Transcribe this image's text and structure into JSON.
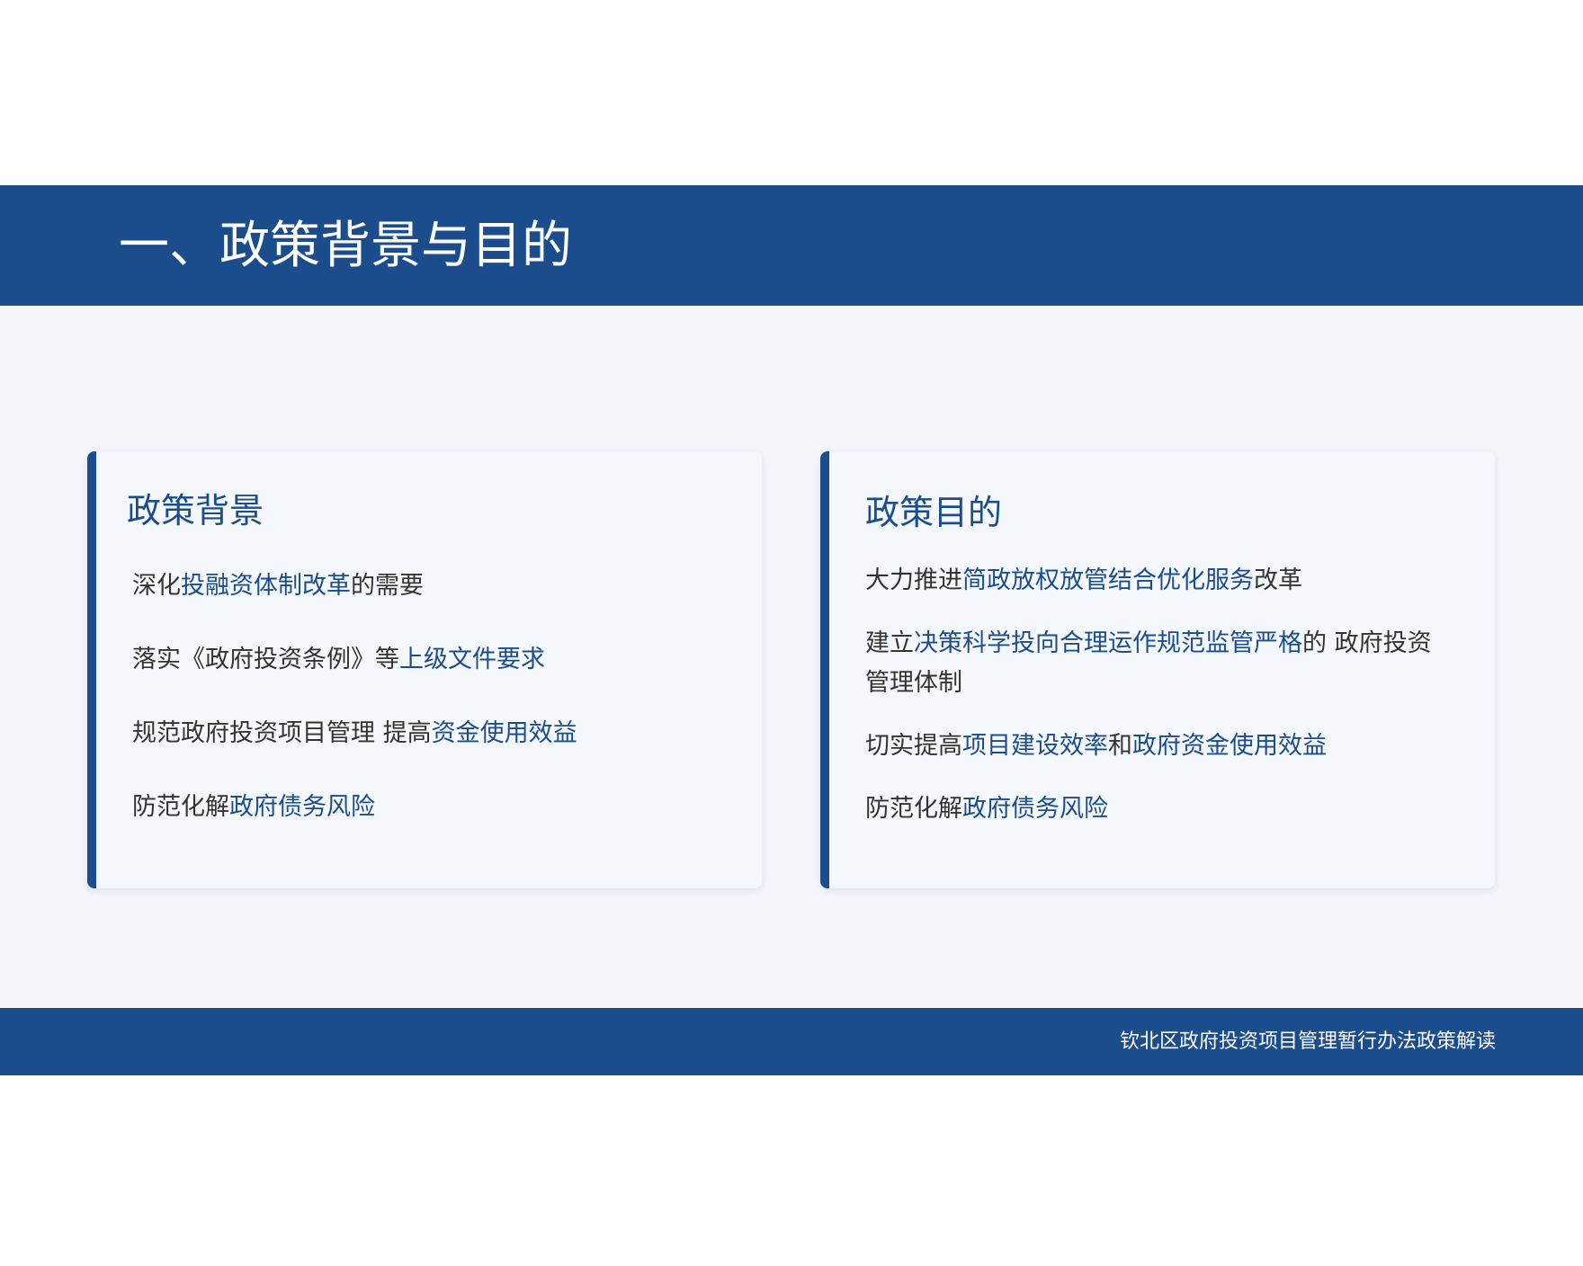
{
  "header": {
    "title": "一、政策背景与目的"
  },
  "cards": [
    {
      "title": "政策背景",
      "items": [
        [
          {
            "text": "深化",
            "hl": false
          },
          {
            "text": "投融资体制改革",
            "hl": true
          },
          {
            "text": "的需要",
            "hl": false
          }
        ],
        [
          {
            "text": "落实《政府投资条例》等",
            "hl": false
          },
          {
            "text": "上级文件要求",
            "hl": true
          }
        ],
        [
          {
            "text": "规范政府投资项目管理 提高",
            "hl": false
          },
          {
            "text": "资金使用效益",
            "hl": true
          }
        ],
        [
          {
            "text": "防范化解",
            "hl": false
          },
          {
            "text": "政府债务风险",
            "hl": true
          }
        ]
      ]
    },
    {
      "title": "政策目的",
      "items": [
        [
          {
            "text": "大力推进",
            "hl": false
          },
          {
            "text": "简政放权放管结合优化服务",
            "hl": true
          },
          {
            "text": "改革",
            "hl": false
          }
        ],
        [
          {
            "text": "建立",
            "hl": false
          },
          {
            "text": "决策科学投向合理运作规范监管严格",
            "hl": true
          },
          {
            "text": "的  政府投资管理体制",
            "hl": false
          }
        ],
        [
          {
            "text": "切实提高",
            "hl": false
          },
          {
            "text": "项目建设效率",
            "hl": true
          },
          {
            "text": "和",
            "hl": false
          },
          {
            "text": "政府资金使用效益",
            "hl": true
          }
        ],
        [
          {
            "text": "防范化解",
            "hl": false
          },
          {
            "text": "政府债务风险",
            "hl": true
          }
        ]
      ]
    }
  ],
  "footer": {
    "text": "钦北区政府投资项目管理暂行办法政策解读"
  },
  "colors": {
    "primary": "#1b4d8c",
    "body_text": "#333333",
    "panel_bg": "#f3f7fb"
  }
}
